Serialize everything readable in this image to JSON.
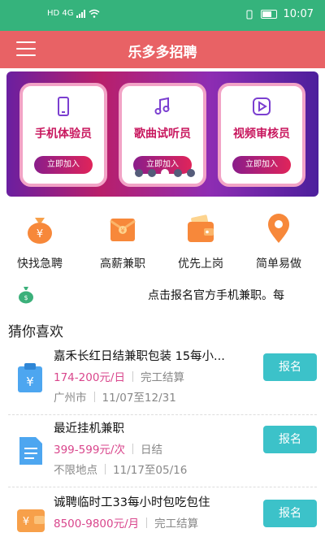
{
  "status": {
    "network": "HD 4G",
    "time": "10:07"
  },
  "appbar": {
    "title": "乐多多招聘"
  },
  "banner": {
    "cards": [
      {
        "title": "手机体验员",
        "button": "立即加入",
        "icon": "phone-icon"
      },
      {
        "title": "歌曲试听员",
        "button": "立即加入",
        "icon": "music-note-icon"
      },
      {
        "title": "视频审核员",
        "button": "立即加入",
        "icon": "play-icon"
      }
    ],
    "active_dot": 3,
    "dot_count": 5
  },
  "quick": [
    {
      "label": "快找急聘",
      "icon": "money-bag-icon"
    },
    {
      "label": "高薪兼职",
      "icon": "red-envelope-icon"
    },
    {
      "label": "优先上岗",
      "icon": "wallet-icon"
    },
    {
      "label": "简单易做",
      "icon": "location-pin-icon"
    }
  ],
  "notice": {
    "text": "点击报名官方手机兼职。每"
  },
  "section": {
    "title": "猜你喜欢"
  },
  "jobs": [
    {
      "title": "嘉禾长红日结兼职包装 15每小...",
      "pay": "174-200元/日",
      "settle": "完工结算",
      "place": "广州市",
      "dates": "11/07至12/31",
      "apply": "报名",
      "icon": "clipboard-yuan-icon"
    },
    {
      "title": "最近挂机兼职",
      "pay": "399-599元/次",
      "settle": "日结",
      "place": "不限地点",
      "dates": "11/17至05/16",
      "apply": "报名",
      "icon": "document-icon"
    },
    {
      "title": "诚聘临时工33每小时包吃包住",
      "pay": "8500-9800元/月",
      "settle": "完工结算",
      "place": "",
      "dates": "",
      "apply": "报名",
      "icon": "wallet-yuan-icon"
    }
  ],
  "colors": {
    "status": "#35b37c",
    "appbar": "#e86265",
    "pay": "#d9468c",
    "apply": "#3cc2c9"
  }
}
